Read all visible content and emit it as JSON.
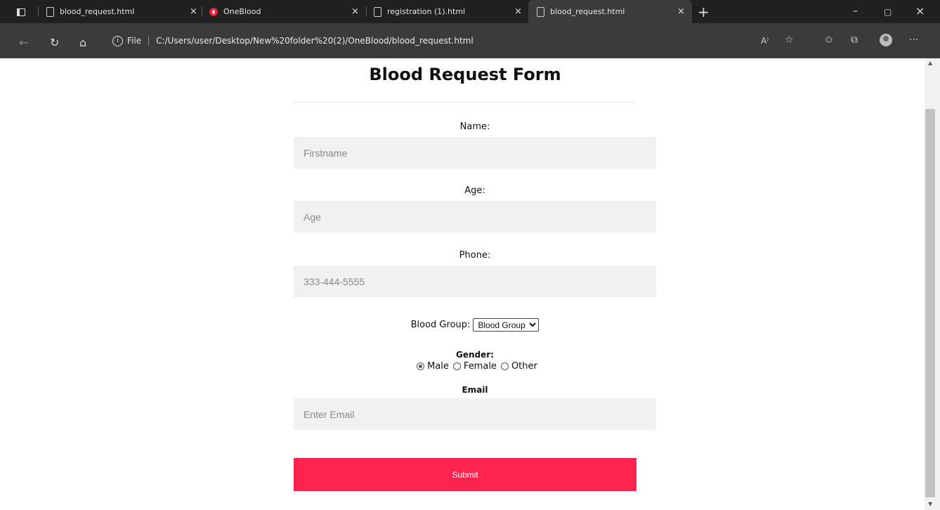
{
  "browser": {
    "tabs": [
      {
        "title": "blood_request.html",
        "close": "×",
        "favicon": "page-icon"
      },
      {
        "title": "OneBlood",
        "close": "×",
        "favicon": "oneblood-logo-icon"
      },
      {
        "title": "registration (1).html",
        "close": "×",
        "favicon": "page-icon"
      },
      {
        "title": "blood_request.html",
        "close": "×",
        "favicon": "page-icon",
        "active": true
      }
    ],
    "new_tab": "+",
    "window_controls": {
      "minimize": "–",
      "restore": "▢",
      "close": "×"
    },
    "nav": {
      "back": "←",
      "reload": "↻",
      "home": "⌂"
    },
    "address": {
      "info": "i",
      "scheme_label": "File",
      "url": "C:/Users/user/Desktop/New%20folder%20(2)/OneBlood/blood_request.html"
    },
    "toolbar": {
      "read_aloud": "A⁾",
      "favorites_add": "☆",
      "favorites": "✩",
      "collections": "⧉",
      "more": "···"
    },
    "scrollbar": {
      "up": "▲",
      "down": "▼"
    }
  },
  "form": {
    "title": "Blood Request Form",
    "name_label": "Name:",
    "name_placeholder": "Firstname",
    "age_label": "Age:",
    "age_placeholder": "Age",
    "phone_label": "Phone:",
    "phone_placeholder": "333-444-5555",
    "blood_group_label": "Blood Group:",
    "blood_group_selected": "Blood Group",
    "gender_label": "Gender:",
    "gender_options": [
      "Male",
      "Female",
      "Other"
    ],
    "gender_selected": "Male",
    "email_label": "Email",
    "email_placeholder": "Enter Email",
    "submit_label": "Submit",
    "submit_color": "#ff2350"
  }
}
